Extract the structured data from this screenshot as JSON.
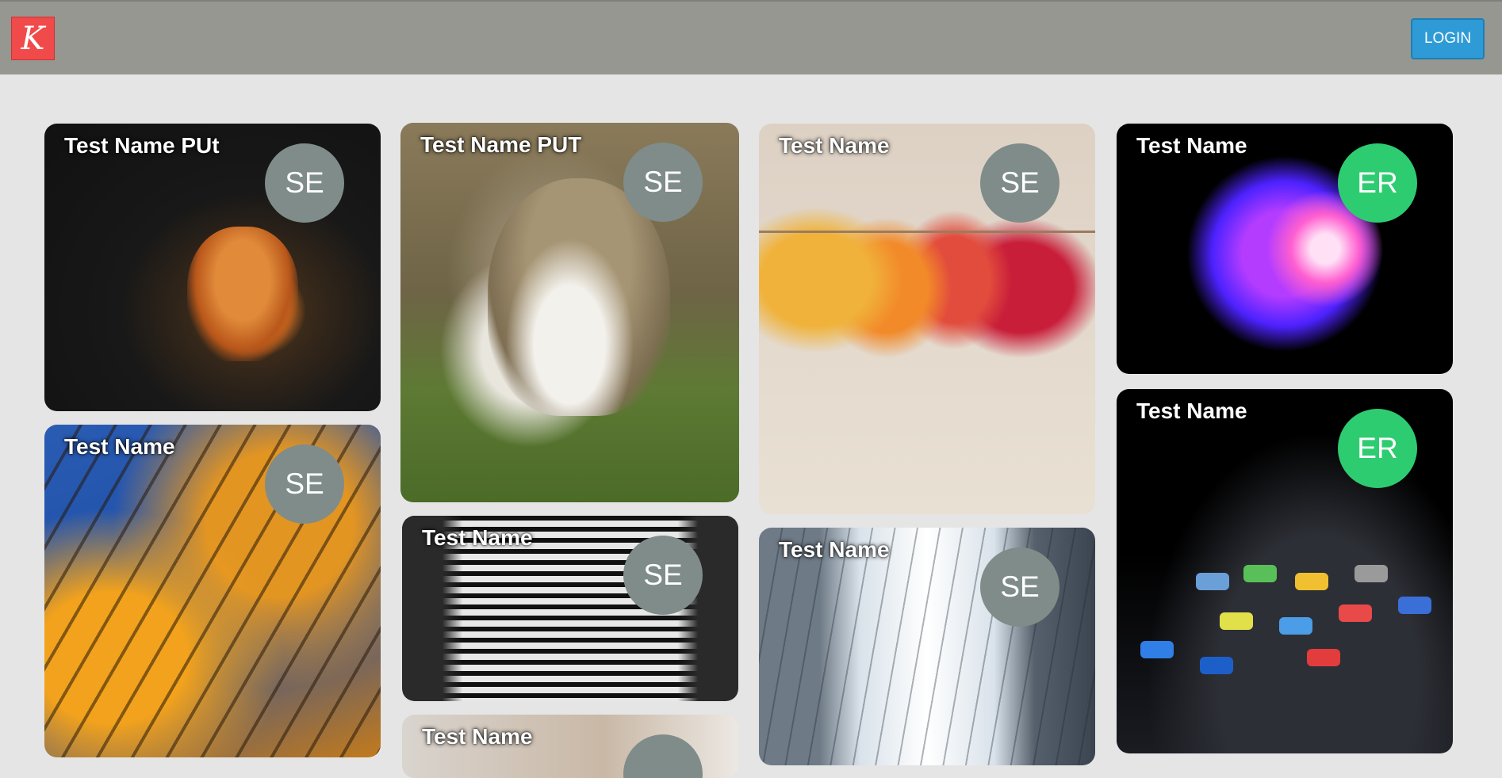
{
  "header": {
    "logo_letter": "K",
    "login_label": "LOGIN"
  },
  "cards": [
    {
      "title": "Test Name PUt",
      "badge": "SE",
      "image": "squirrel"
    },
    {
      "title": "Test Name PUT",
      "badge": "SE",
      "image": "cat"
    },
    {
      "title": "Test Name",
      "badge": "SE",
      "image": "autumn-leaves"
    },
    {
      "title": "Test Name",
      "badge": "ER",
      "image": "glowing-sphere"
    },
    {
      "title": "Test Name",
      "badge": "SE",
      "image": "autumn-forest"
    },
    {
      "title": "Test Name",
      "badge": "SE",
      "image": "building-stairs"
    },
    {
      "title": "Test Name",
      "badge": "SE",
      "image": "glass-buildings-sky"
    },
    {
      "title": "Test Name",
      "badge": "ER",
      "image": "phone-apps"
    },
    {
      "title": "Test Name",
      "badge": "",
      "image": "hand"
    }
  ],
  "colors": {
    "topbar": "#969791",
    "background": "#e5e5e5",
    "login_button": "#2f9bd6",
    "badge_se": "#7f8c8a",
    "badge_er": "#2ecc71",
    "logo": "#f04a4a"
  }
}
